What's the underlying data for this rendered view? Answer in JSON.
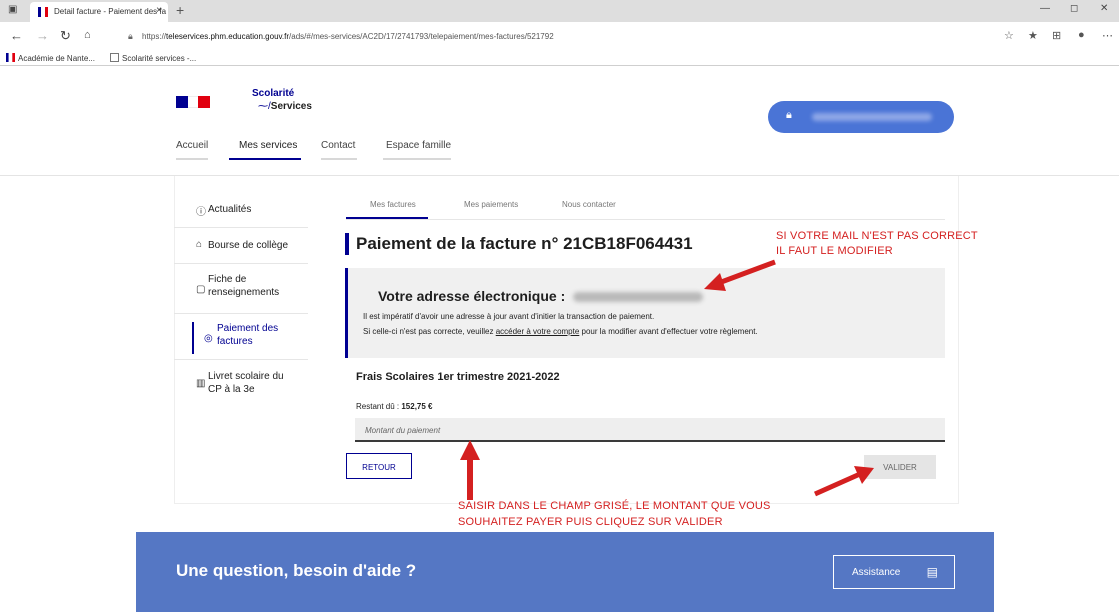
{
  "browser": {
    "tab_title": "Detail facture - Paiement des fa",
    "tab_close": "×",
    "new_tab": "+",
    "url_prefix": "https://",
    "url_domain": "teleservices.phm.education.gouv.fr",
    "url_rest": "/ads/#/mes-services/AC2D/17/2741793/telepaiement/mes-factures/521792",
    "bookmarks": [
      "Académie de Nante...",
      "Scolarité services -..."
    ]
  },
  "header": {
    "logo_line1": "Scolarité",
    "logo_line2": "Services",
    "nav": [
      "Accueil",
      "Mes services",
      "Contact",
      "Espace famille"
    ]
  },
  "sidebar": {
    "items": [
      {
        "label": "Actualités",
        "icon": "info-icon"
      },
      {
        "label": "Bourse de collège",
        "icon": "bank-icon"
      },
      {
        "label": "Fiche de renseignements",
        "icon": "document-icon"
      },
      {
        "label": "Paiement des factures",
        "icon": "payment-icon"
      },
      {
        "label": "Livret scolaire du CP à la 3e",
        "icon": "book-icon"
      }
    ]
  },
  "content_tabs": [
    "Mes factures",
    "Mes paiements",
    "Nous contacter"
  ],
  "page_title": "Paiement de la facture n° 21CB18F064431",
  "email_box": {
    "label": "Votre adresse électronique :",
    "line1": "Il est impératif d'avoir une adresse à jour avant d'initier la transaction de paiement.",
    "line2_before": "Si celle-ci n'est pas correcte, veuillez ",
    "line2_link": "accéder à votre compte",
    "line2_after": " pour la modifier avant d'effectuer votre règlement."
  },
  "fees": {
    "title": "Frais Scolaires 1er trimestre 2021-2022",
    "due_label": "Restant dû : ",
    "due_value": "152,75 €",
    "amount_placeholder": "Montant du paiement"
  },
  "buttons": {
    "back": "RETOUR",
    "validate": "VALIDER"
  },
  "annotations": {
    "mail_1": "SI VOTRE MAIL N'EST PAS CORRECT",
    "mail_2": "IL FAUT LE MODIFIER",
    "amount_1": "SAISIR DANS LE CHAMP GRISÉ, LE MONTANT QUE VOUS",
    "amount_2": "SOUHAITEZ PAYER PUIS CLIQUEZ SUR VALIDER"
  },
  "footer": {
    "question": "Une question, besoin d'aide ?",
    "assistance": "Assistance"
  },
  "colors": {
    "accent": "#000091",
    "footer": "#5577c4",
    "user_button": "#4a74d6",
    "annotation": "#d42020"
  }
}
